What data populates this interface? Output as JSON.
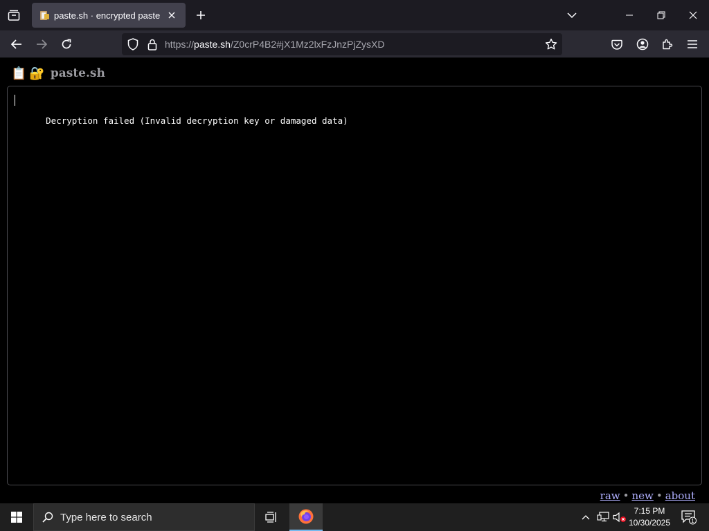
{
  "browser": {
    "tab": {
      "title": "paste.sh · encrypted pastebin",
      "favicon": "clipboard-lock-icon"
    },
    "url": {
      "scheme": "https://",
      "host": "paste.sh",
      "path": "/Z0crP4B2#jX1Mz2lxFzJnzPjZysXD"
    }
  },
  "page": {
    "header": {
      "emoji_clipboard": "📋",
      "emoji_lock": "🔐",
      "title": "paste.sh"
    },
    "paste_content": "Decryption failed (Invalid decryption key or damaged data)",
    "footer": {
      "raw": "raw",
      "new": "new",
      "about": "about",
      "separator": "•"
    }
  },
  "taskbar": {
    "search_placeholder": "Type here to search",
    "time": "7:15 PM",
    "date": "10/30/2025",
    "notification_count": "1"
  },
  "colors": {
    "tabstrip_bg": "#1c1b22",
    "active_tab_bg": "#42414d",
    "navbar_bg": "#2b2a33",
    "page_bg": "#000000",
    "link": "#b0b0ff"
  }
}
